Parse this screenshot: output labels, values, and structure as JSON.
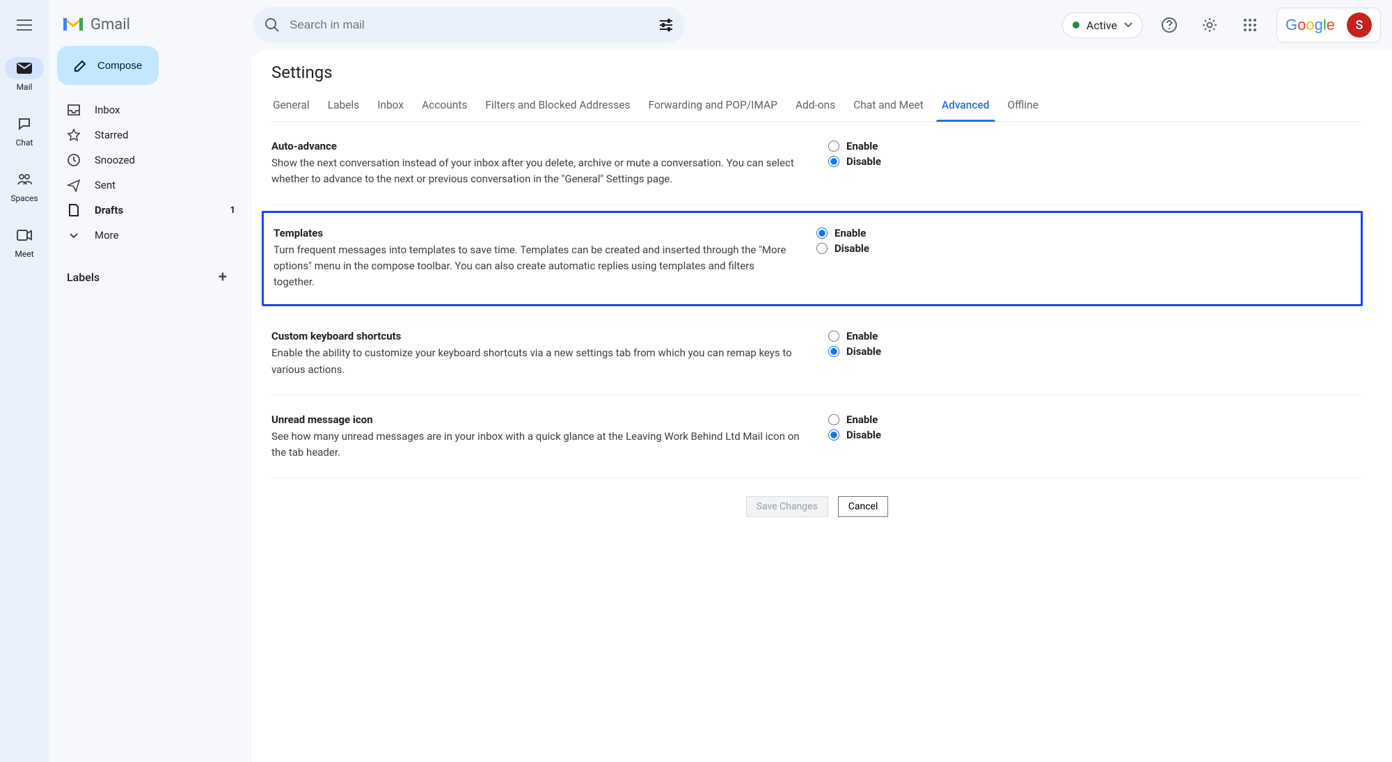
{
  "rail": {
    "items": [
      {
        "label": "Mail",
        "active": true
      },
      {
        "label": "Chat"
      },
      {
        "label": "Spaces"
      },
      {
        "label": "Meet"
      }
    ]
  },
  "brand": {
    "name": "Gmail"
  },
  "compose": {
    "label": "Compose"
  },
  "sidebar": {
    "items": [
      {
        "label": "Inbox"
      },
      {
        "label": "Starred"
      },
      {
        "label": "Snoozed"
      },
      {
        "label": "Sent"
      },
      {
        "label": "Drafts",
        "count": "1",
        "bold": true
      },
      {
        "label": "More"
      }
    ],
    "labels_heading": "Labels"
  },
  "search": {
    "placeholder": "Search in mail"
  },
  "status": {
    "label": "Active"
  },
  "google": {
    "label": "Google",
    "avatar_initial": "S"
  },
  "settings": {
    "title": "Settings",
    "tabs": [
      "General",
      "Labels",
      "Inbox",
      "Accounts",
      "Filters and Blocked Addresses",
      "Forwarding and POP/IMAP",
      "Add-ons",
      "Chat and Meet",
      "Advanced",
      "Offline"
    ],
    "active_tab": "Advanced",
    "options": [
      {
        "title": "Auto-advance",
        "text": "Show the next conversation instead of your inbox after you delete, archive or mute a conversation. You can select whether to advance to the next or previous conversation in the \"General\" Settings page.",
        "enable": "Enable",
        "disable": "Disable",
        "value": "disable",
        "highlight": false
      },
      {
        "title": "Templates",
        "text": "Turn frequent messages into templates to save time. Templates can be created and inserted through the \"More options\" menu in the compose toolbar. You can also create automatic replies using templates and filters together.",
        "enable": "Enable",
        "disable": "Disable",
        "value": "enable",
        "highlight": true
      },
      {
        "title": "Custom keyboard shortcuts",
        "text": "Enable the ability to customize your keyboard shortcuts via a new settings tab from which you can remap keys to various actions.",
        "enable": "Enable",
        "disable": "Disable",
        "value": "disable",
        "highlight": false
      },
      {
        "title": "Unread message icon",
        "text": "See how many unread messages are in your inbox with a quick glance at the Leaving Work Behind Ltd Mail icon on the tab header.",
        "enable": "Enable",
        "disable": "Disable",
        "value": "disable",
        "highlight": false
      }
    ],
    "save_label": "Save Changes",
    "cancel_label": "Cancel"
  }
}
